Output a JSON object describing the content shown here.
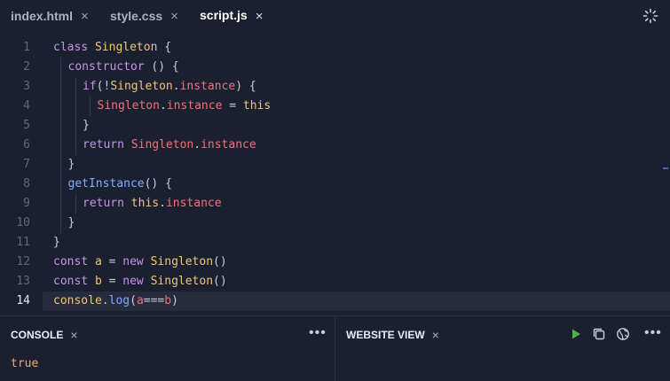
{
  "tabs": [
    {
      "label": "index.html",
      "active": false
    },
    {
      "label": "style.css",
      "active": false
    },
    {
      "label": "script.js",
      "active": true
    }
  ],
  "tab_close_glyph": "×",
  "editor": {
    "line_numbers": [
      "1",
      "2",
      "3",
      "4",
      "5",
      "6",
      "7",
      "8",
      "9",
      "10",
      "11",
      "12",
      "13",
      "14"
    ],
    "current_line": "14",
    "lines": [
      [
        {
          "t": "class ",
          "c": "kw-c"
        },
        {
          "t": "Singleton",
          "c": "cls"
        },
        {
          "t": " {",
          "c": "plain"
        }
      ],
      [
        {
          "t": "constructor",
          "c": "kw-c"
        },
        {
          "t": " () {",
          "c": "plain"
        }
      ],
      [
        {
          "t": "if",
          "c": "kw-c"
        },
        {
          "t": "(!",
          "c": "plain"
        },
        {
          "t": "Singleton",
          "c": "cls"
        },
        {
          "t": ".",
          "c": "plain"
        },
        {
          "t": "instance",
          "c": "prop"
        },
        {
          "t": ") {",
          "c": "plain"
        }
      ],
      [
        {
          "t": "Singleton",
          "c": "prop"
        },
        {
          "t": ".",
          "c": "plain"
        },
        {
          "t": "instance",
          "c": "prop"
        },
        {
          "t": " = ",
          "c": "plain"
        },
        {
          "t": "this",
          "c": "this"
        }
      ],
      [
        {
          "t": "}",
          "c": "plain"
        }
      ],
      [
        {
          "t": "return ",
          "c": "kw-c"
        },
        {
          "t": "Singleton",
          "c": "prop"
        },
        {
          "t": ".",
          "c": "plain"
        },
        {
          "t": "instance",
          "c": "prop"
        }
      ],
      [
        {
          "t": "}",
          "c": "plain"
        }
      ],
      [
        {
          "t": "getInstance",
          "c": "fn"
        },
        {
          "t": "() {",
          "c": "plain"
        }
      ],
      [
        {
          "t": "return ",
          "c": "kw-c"
        },
        {
          "t": "this",
          "c": "this"
        },
        {
          "t": ".",
          "c": "plain"
        },
        {
          "t": "instance",
          "c": "prop"
        }
      ],
      [
        {
          "t": "}",
          "c": "plain"
        }
      ],
      [
        {
          "t": "}",
          "c": "plain"
        }
      ],
      [
        {
          "t": "const ",
          "c": "kw-c"
        },
        {
          "t": "a",
          "c": "var"
        },
        {
          "t": " = ",
          "c": "plain"
        },
        {
          "t": "new ",
          "c": "kw-c"
        },
        {
          "t": "Singleton",
          "c": "cls"
        },
        {
          "t": "()",
          "c": "plain"
        }
      ],
      [
        {
          "t": "const ",
          "c": "kw-c"
        },
        {
          "t": "b",
          "c": "var"
        },
        {
          "t": " = ",
          "c": "plain"
        },
        {
          "t": "new ",
          "c": "kw-c"
        },
        {
          "t": "Singleton",
          "c": "cls"
        },
        {
          "t": "()",
          "c": "plain"
        }
      ],
      [
        {
          "t": "console",
          "c": "this"
        },
        {
          "t": ".",
          "c": "plain"
        },
        {
          "t": "log",
          "c": "fn"
        },
        {
          "t": "(",
          "c": "plain"
        },
        {
          "t": "a",
          "c": "prop"
        },
        {
          "t": "===",
          "c": "plain"
        },
        {
          "t": "b",
          "c": "prop"
        },
        {
          "t": ")",
          "c": "plain"
        }
      ]
    ],
    "indent_levels": [
      0,
      1,
      2,
      3,
      2,
      2,
      1,
      1,
      2,
      1,
      0,
      0,
      0,
      0
    ]
  },
  "console_panel": {
    "title": "CONSOLE",
    "close_glyph": "×",
    "more_glyph": "•••",
    "output": "true"
  },
  "website_panel": {
    "title": "WEBSITE VIEW",
    "close_glyph": "×",
    "more_glyph": "•••",
    "icons": [
      "play-icon",
      "copy-icon",
      "globe-icon"
    ]
  },
  "colors": {
    "background": "#1b2030",
    "keyword": "#c792ea",
    "class": "#f0c674",
    "property": "#f07178",
    "function": "#82aaff",
    "run": "#4caf50",
    "console_output": "#f0a868"
  }
}
